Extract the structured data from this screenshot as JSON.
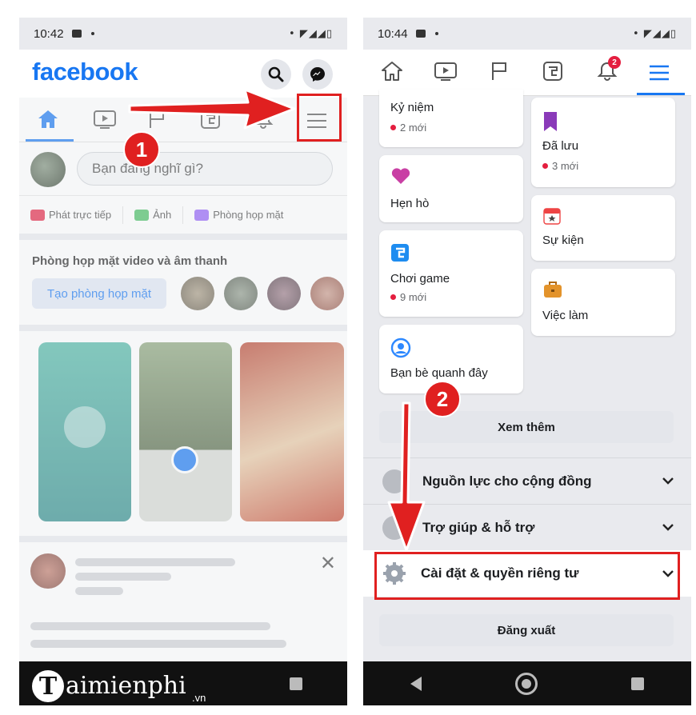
{
  "left_screen": {
    "status_time": "10:42",
    "logo": "facebook",
    "header_icons": [
      "search-icon",
      "messenger-icon"
    ],
    "tabs": [
      "home-icon",
      "video-icon",
      "flag-icon",
      "gaming-icon",
      "bell-icon",
      "menu-icon"
    ],
    "composer_placeholder": "Bạn đang nghĩ gì?",
    "actions": [
      "Phát trực tiếp",
      "Ảnh",
      "Phòng họp mặt"
    ],
    "rooms_title": "Phòng họp mặt video và âm thanh",
    "rooms_button": "Tạo phòng họp mặt",
    "step_marker": "1"
  },
  "right_screen": {
    "status_time": "10:44",
    "notification_badge": "2",
    "tabs": [
      "home-icon",
      "video-icon",
      "flag-icon",
      "gaming-icon",
      "bell-icon",
      "menu-icon"
    ],
    "left_cards": [
      {
        "title": "Kỷ niệm",
        "sub": "2 mới"
      },
      {
        "title": "Hẹn hò",
        "sub": ""
      },
      {
        "title": "Chơi game",
        "sub": "9 mới"
      },
      {
        "title": "Bạn bè quanh đây",
        "sub": ""
      }
    ],
    "right_cards": [
      {
        "title": "Đã lưu",
        "sub": "3 mới"
      },
      {
        "title": "Sự kiện",
        "sub": ""
      },
      {
        "title": "Việc làm",
        "sub": ""
      }
    ],
    "see_more": "Xem thêm",
    "sections": [
      {
        "label": "Nguồn lực cho cộng đồng"
      },
      {
        "label": "Trợ giúp & hỗ trợ"
      },
      {
        "label": "Cài đặt & quyền riêng tư"
      }
    ],
    "logout": "Đăng xuất",
    "step_marker": "2"
  },
  "watermark": {
    "brand": "aimienphi",
    "brand_initial": "T",
    "suffix": ".vn"
  },
  "colors": {
    "facebook_blue": "#1877f2",
    "annotation_red": "#e02020",
    "notification_red": "#e41e3f"
  }
}
